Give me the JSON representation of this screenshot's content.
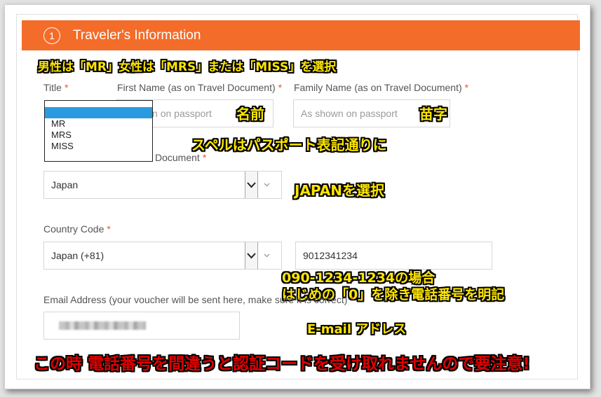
{
  "header": {
    "step_number": "1",
    "title": "Traveler's Information"
  },
  "fields": {
    "title_label": "Title",
    "first_name_label": "First Name (as on Travel Document)",
    "first_name_placeholder": "Shown on passport",
    "family_name_label": "Family Name (as on Travel Document)",
    "family_name_placeholder": "As shown on passport",
    "document_label": "Document",
    "document_value": "Japan",
    "country_code_label": "Country Code",
    "country_code_value": "Japan (+81)",
    "phone_value": "9012341234",
    "email_label": "Email Address (your voucher will be sent here, make sure it is correct)",
    "required_mark": "*"
  },
  "title_dropdown": {
    "options": [
      "",
      "MR",
      "MRS",
      "MISS"
    ],
    "selected_index": 0
  },
  "annotations": {
    "title_note": "男性は「MR」女性は「MRS」または「MISS」を選択",
    "first_name_note": "名前",
    "family_name_note": "苗字",
    "spelling_note": "スペルはパスポート表記通りに",
    "japan_note": "JAPANを選択",
    "phone_note_1": "090-1234-1234の場合",
    "phone_note_2": "はじめの「0」を除き電話番号を明記",
    "email_note": "E-mail アドレス",
    "warning_note": "この時 電話番号を間違うと認証コードを受け取れませんので要注意!"
  },
  "colors": {
    "header": "#f36c29",
    "required": "#e8562a",
    "selected_option": "#2a9be0",
    "annotation_yellow": "#ffe600",
    "annotation_red": "#e00000"
  }
}
